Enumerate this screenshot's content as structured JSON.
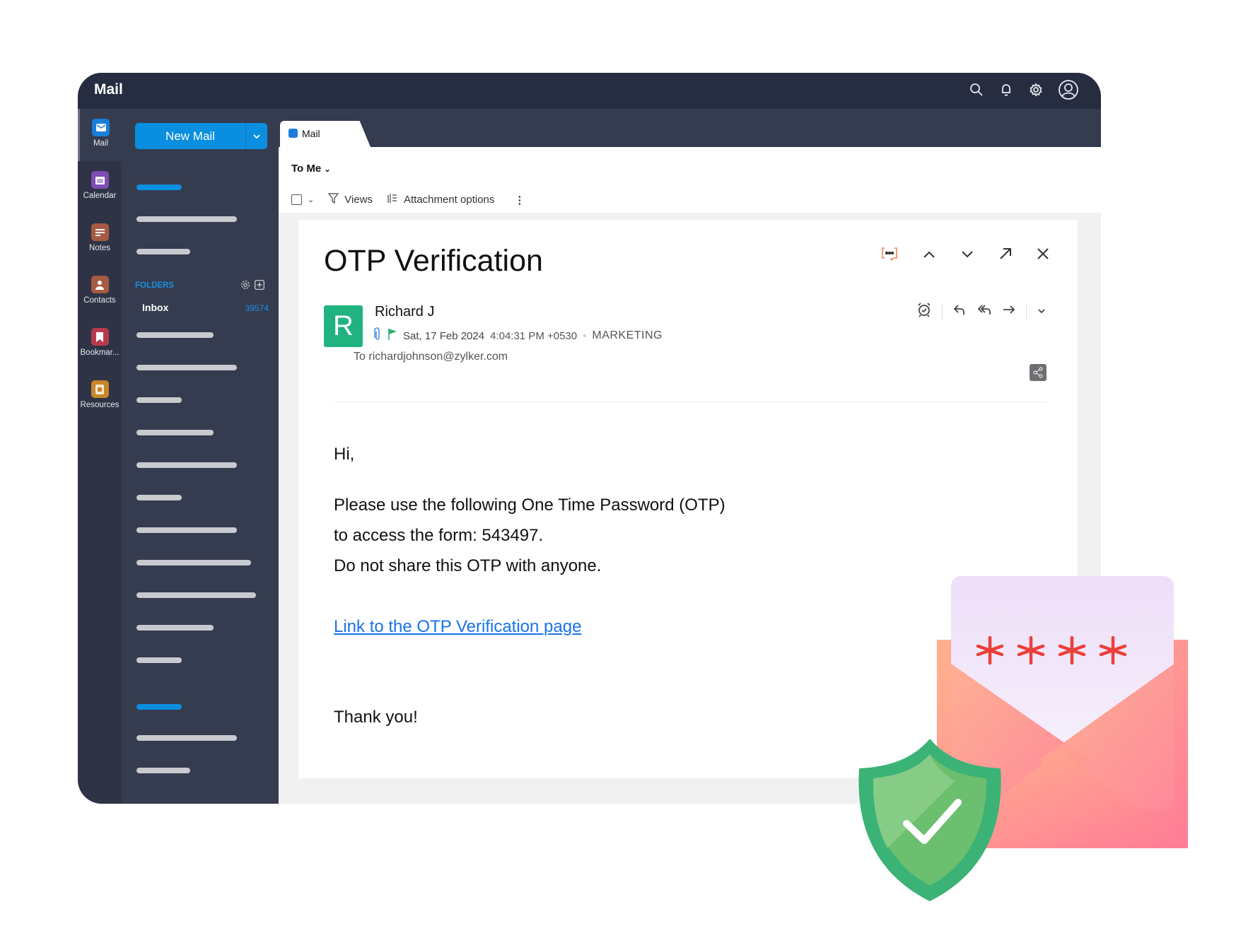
{
  "app": {
    "title": "Mail"
  },
  "topbar": {
    "icons": [
      "search-icon",
      "bell-icon",
      "gear-icon",
      "user-avatar-icon"
    ]
  },
  "rail": {
    "items": [
      {
        "label": "Mail",
        "icon": "mail-icon",
        "color": "#1a7ddb",
        "active": true
      },
      {
        "label": "Calendar",
        "icon": "calendar-icon",
        "color": "#7e4db3"
      },
      {
        "label": "Notes",
        "icon": "notes-icon",
        "color": "#a75a43"
      },
      {
        "label": "Contacts",
        "icon": "contacts-icon",
        "color": "#a75a43"
      },
      {
        "label": "Bookmar...",
        "icon": "bookmark-icon",
        "color": "#b83a4f"
      },
      {
        "label": "Resources",
        "icon": "resources-icon",
        "color": "#c9862b"
      }
    ]
  },
  "folders": {
    "new_mail_label": "New Mail",
    "header": "FOLDERS",
    "inbox_label": "Inbox",
    "inbox_count": "39574"
  },
  "tab": {
    "label": "Mail"
  },
  "toolbar": {
    "filter_label": "To Me",
    "views_label": "Views",
    "attachment_label": "Attachment options"
  },
  "email": {
    "subject": "OTP Verification",
    "avatar_letter": "R",
    "sender": "Richard J",
    "date": "Sat, 17 Feb 2024",
    "time": "4:04:31 PM +0530",
    "tag": "MARKETING",
    "to_label": "To",
    "to_address": "richardjohnson@zylker.com",
    "greeting": "Hi,",
    "line1": "Please use the following One Time Password (OTP)",
    "line2": "to access the form: 543497.",
    "line3": "Do not share this OTP with anyone.",
    "link": "Link to the OTP Verification page",
    "closing": "Thank you!"
  },
  "illustration": {
    "masked_code": "* * * *"
  }
}
